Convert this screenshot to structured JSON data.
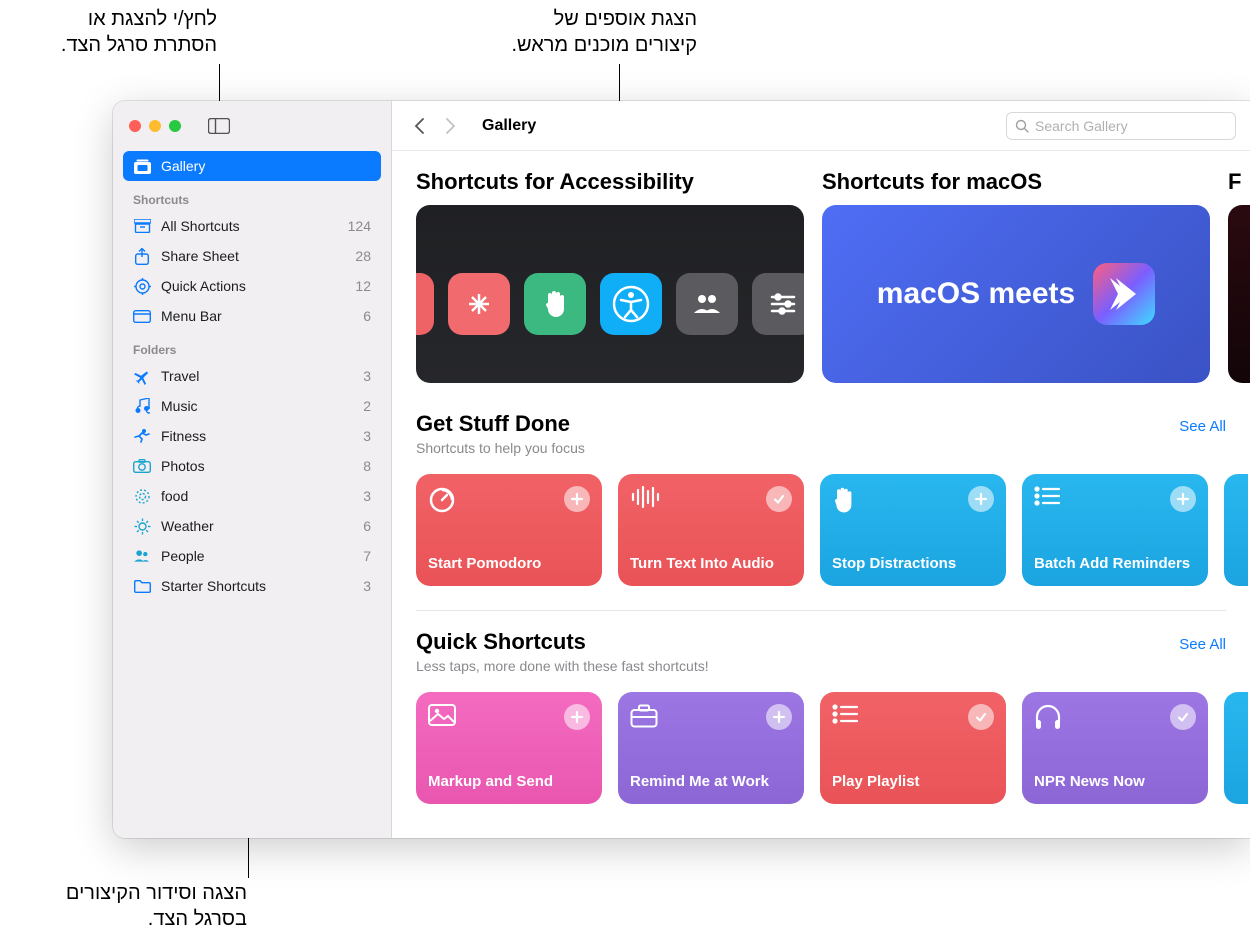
{
  "callouts": {
    "sidebar_toggle": "לחץ/י להצגת או\nהסתרת סרגל הצד.",
    "collections": "הצגת אוספים של\nקיצורים מוכנים מראש.",
    "sidebar_org": "הצגה וסידור הקיצורים\nבסרגל הצד."
  },
  "window": {
    "title": "Gallery",
    "search_placeholder": "Search Gallery"
  },
  "sidebar": {
    "gallery_label": "Gallery",
    "section_shortcuts": "Shortcuts",
    "section_folders": "Folders",
    "shortcuts": [
      {
        "icon": "archivebox",
        "label": "All Shortcuts",
        "count": "124"
      },
      {
        "icon": "share",
        "label": "Share Sheet",
        "count": "28"
      },
      {
        "icon": "gear",
        "label": "Quick Actions",
        "count": "12"
      },
      {
        "icon": "menubar",
        "label": "Menu Bar",
        "count": "6"
      }
    ],
    "folders": [
      {
        "icon": "airplane",
        "color": "#0a7aff",
        "label": "Travel",
        "count": "3"
      },
      {
        "icon": "music",
        "color": "#0a7aff",
        "label": "Music",
        "count": "2"
      },
      {
        "icon": "fitness",
        "color": "#0a7aff",
        "label": "Fitness",
        "count": "3"
      },
      {
        "icon": "camera",
        "color": "#1aa5d0",
        "label": "Photos",
        "count": "8"
      },
      {
        "icon": "burst",
        "color": "#1aa5d0",
        "label": "food",
        "count": "3"
      },
      {
        "icon": "sun",
        "color": "#1aa5d0",
        "label": "Weather",
        "count": "6"
      },
      {
        "icon": "people",
        "color": "#1aa5d0",
        "label": "People",
        "count": "7"
      },
      {
        "icon": "folder",
        "color": "#0a7aff",
        "label": "Starter Shortcuts",
        "count": "3"
      }
    ]
  },
  "banners": {
    "accessibility_title": "Shortcuts for Accessibility",
    "macos_title": "Shortcuts for macOS",
    "macos_text": "macOS meets",
    "partial_title": "F"
  },
  "sections": [
    {
      "title": "Get Stuff Done",
      "subtitle": "Shortcuts to help you focus",
      "see_all": "See All",
      "cards": [
        {
          "color": "c-red",
          "icon": "timer",
          "badge": "plus",
          "label": "Start Pomodoro"
        },
        {
          "color": "c-red",
          "icon": "wave",
          "badge": "check",
          "label": "Turn Text Into Audio"
        },
        {
          "color": "c-blue",
          "icon": "hand",
          "badge": "plus",
          "label": "Stop Distractions"
        },
        {
          "color": "c-blue",
          "icon": "list",
          "badge": "plus",
          "label": "Batch Add Reminders"
        }
      ]
    },
    {
      "title": "Quick Shortcuts",
      "subtitle": "Less taps, more done with these fast shortcuts!",
      "see_all": "See All",
      "cards": [
        {
          "color": "c-pink",
          "icon": "photo",
          "badge": "plus",
          "label": "Markup and Send"
        },
        {
          "color": "c-purple",
          "icon": "briefcase",
          "badge": "plus",
          "label": "Remind Me at Work"
        },
        {
          "color": "c-red",
          "icon": "list",
          "badge": "check",
          "label": "Play Playlist"
        },
        {
          "color": "c-purple",
          "icon": "headphones",
          "badge": "check",
          "label": "NPR News Now"
        }
      ]
    }
  ]
}
